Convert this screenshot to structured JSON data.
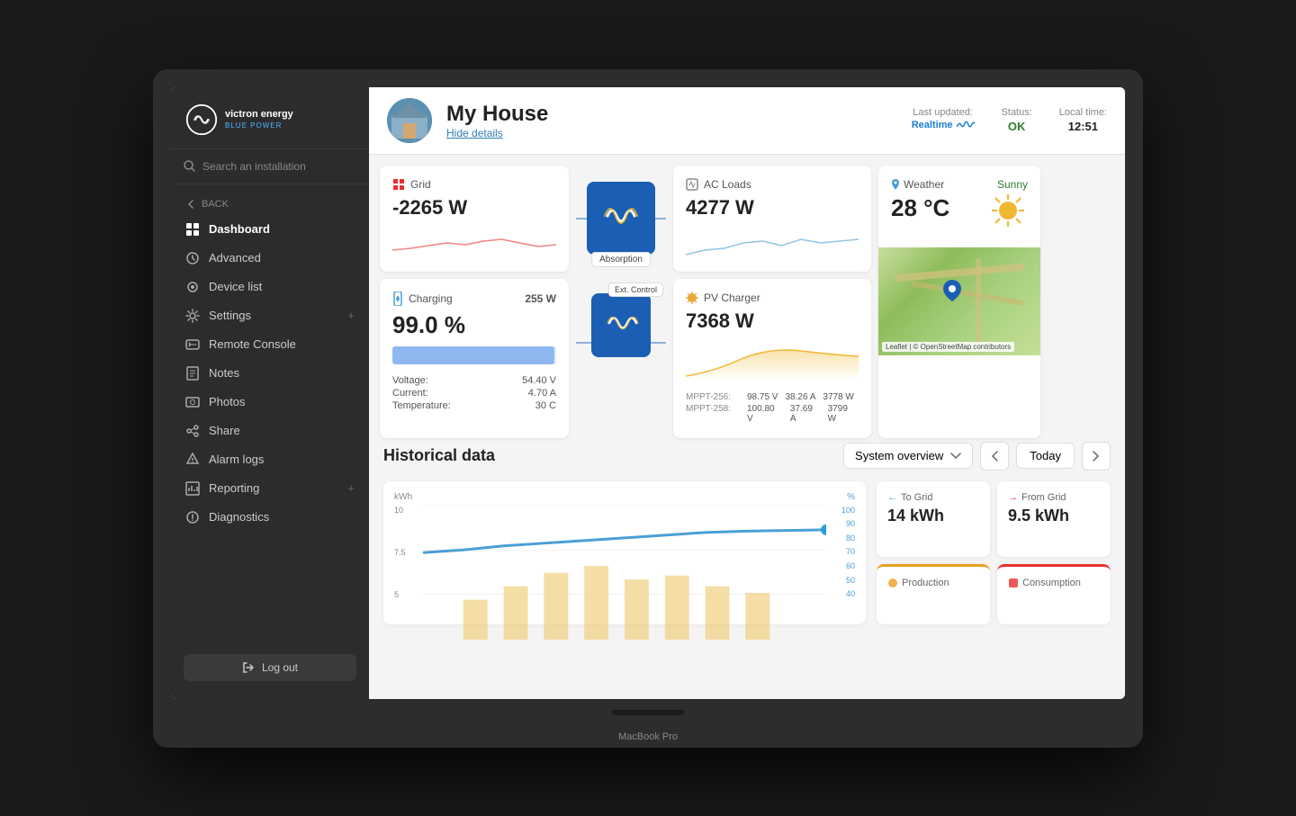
{
  "app": {
    "name": "Victron Energy VRM",
    "device": "MacBook Pro"
  },
  "sidebar": {
    "logo": {
      "brand": "victron energy",
      "tagline": "blue power"
    },
    "search": {
      "placeholder": "Search an installation"
    },
    "back_label": "BACK",
    "nav_items": [
      {
        "id": "dashboard",
        "label": "Dashboard",
        "active": true
      },
      {
        "id": "advanced",
        "label": "Advanced",
        "active": false
      },
      {
        "id": "device-list",
        "label": "Device list",
        "active": false
      },
      {
        "id": "settings",
        "label": "Settings",
        "active": false,
        "has_plus": true
      },
      {
        "id": "remote-console",
        "label": "Remote Console",
        "active": false
      },
      {
        "id": "notes",
        "label": "Notes",
        "active": false
      },
      {
        "id": "photos",
        "label": "Photos",
        "active": false
      },
      {
        "id": "share",
        "label": "Share",
        "active": false
      },
      {
        "id": "alarm-logs",
        "label": "Alarm logs",
        "active": false
      },
      {
        "id": "reporting",
        "label": "Reporting",
        "active": false,
        "has_plus": true
      },
      {
        "id": "diagnostics",
        "label": "Diagnostics",
        "active": false
      }
    ],
    "logout_label": "Log out"
  },
  "header": {
    "house_name": "My House",
    "hide_details": "Hide details",
    "last_updated_label": "Last updated:",
    "last_updated_value": "Realtime",
    "status_label": "Status:",
    "status_value": "OK",
    "local_time_label": "Local time:",
    "local_time_value": "12:51"
  },
  "grid_card": {
    "title": "Grid",
    "value": "-2265 W"
  },
  "inverter_card": {
    "badge": "Absorption"
  },
  "ac_loads_card": {
    "title": "AC Loads",
    "value": "4277 W"
  },
  "charging_card": {
    "title": "Charging",
    "wattage": "255 W",
    "percentage": "99.0 %",
    "charge_percent": 99,
    "voltage_label": "Voltage:",
    "voltage_value": "54.40 V",
    "current_label": "Current:",
    "current_value": "4.70 A",
    "temperature_label": "Temperature:",
    "temperature_value": "30 C"
  },
  "inverter2_card": {
    "badge": "Ext. Control"
  },
  "pv_charger_card": {
    "title": "PV Charger",
    "value": "7368 W",
    "mppt256_label": "MPPT-256:",
    "mppt256_v": "98.75 V",
    "mppt256_a": "38.26 A",
    "mppt256_w": "3778 W",
    "mppt258_label": "MPPT-258:",
    "mppt258_v": "100.80 V",
    "mppt258_a": "37.69 A",
    "mppt258_w": "3799 W"
  },
  "weather_card": {
    "location": "Weather",
    "status": "Sunny",
    "temperature": "28 °C",
    "map_label": "Leaflet | © OpenStreetMap contributors"
  },
  "historical": {
    "title": "Historical data",
    "dropdown_label": "System overview",
    "nav_prev": "<",
    "nav_next": ">",
    "today_label": "Today",
    "y_axis_label": "kWh",
    "y2_axis_label": "%",
    "y_values": [
      "10",
      "7.5",
      "5"
    ],
    "y2_values": [
      "100",
      "90",
      "80",
      "70",
      "60",
      "50",
      "40"
    ]
  },
  "stat_cards": [
    {
      "id": "to-grid",
      "arrow": "←",
      "label": "To Grid",
      "value": "14 kWh",
      "color": "#4a9fd4"
    },
    {
      "id": "from-grid",
      "arrow": "→",
      "label": "From Grid",
      "value": "9.5 kWh",
      "color": "#e83030"
    },
    {
      "id": "production",
      "label": "Production",
      "value": "",
      "type": "production"
    },
    {
      "id": "consumption",
      "label": "Consumption",
      "value": "",
      "type": "consumption"
    }
  ]
}
